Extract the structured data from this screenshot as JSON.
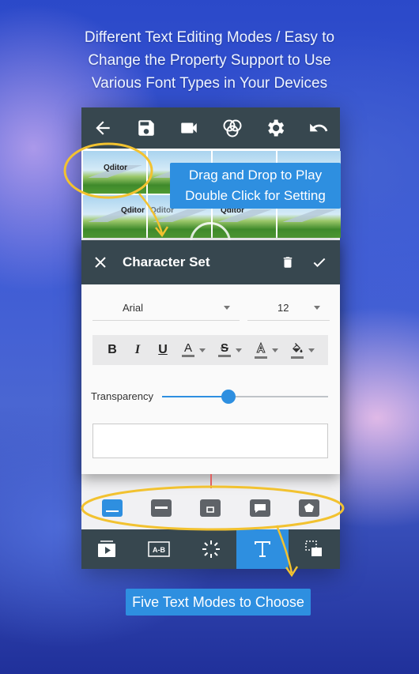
{
  "headline": {
    "line1": "Different Text Editing Modes / Easy to",
    "line2": "Change the Property Support to Use",
    "line3": "Various Font Types in Your Devices"
  },
  "toolbar": {
    "icons": [
      "back-arrow-icon",
      "save-icon",
      "video-camera-icon",
      "color-filter-icon",
      "gear-icon",
      "undo-icon"
    ]
  },
  "timeline": {
    "thumb_label_1": "Qditor",
    "thumb_label_2": "Qditor",
    "thumb_label_3": "Qditor",
    "thumb_label_4": "Qditor"
  },
  "callout": {
    "line1": "Drag and Drop to Play",
    "line2": "Double Click for Setting"
  },
  "dialog": {
    "title": "Character Set",
    "font": "Arial",
    "size": "12",
    "transparency_label": "Transparency",
    "transparency_value": 0.4,
    "text_value": ""
  },
  "modes": {
    "icons": [
      "bottom-bar-mode-icon",
      "middle-bar-mode-icon",
      "box-mode-icon",
      "speech-bubble-mode-icon",
      "badge-mode-icon"
    ],
    "selected": 0
  },
  "bottom_bar": {
    "icons": [
      "clip-play-icon",
      "transition-ab-icon",
      "effects-sparkle-icon",
      "text-tool-icon",
      "overlay-layers-icon"
    ],
    "selected": 3
  },
  "caption": "Five Text Modes to Choose",
  "colors": {
    "accent": "#2e8fe0",
    "toolbar": "#37474f",
    "highlight_stroke": "#f2c230"
  }
}
